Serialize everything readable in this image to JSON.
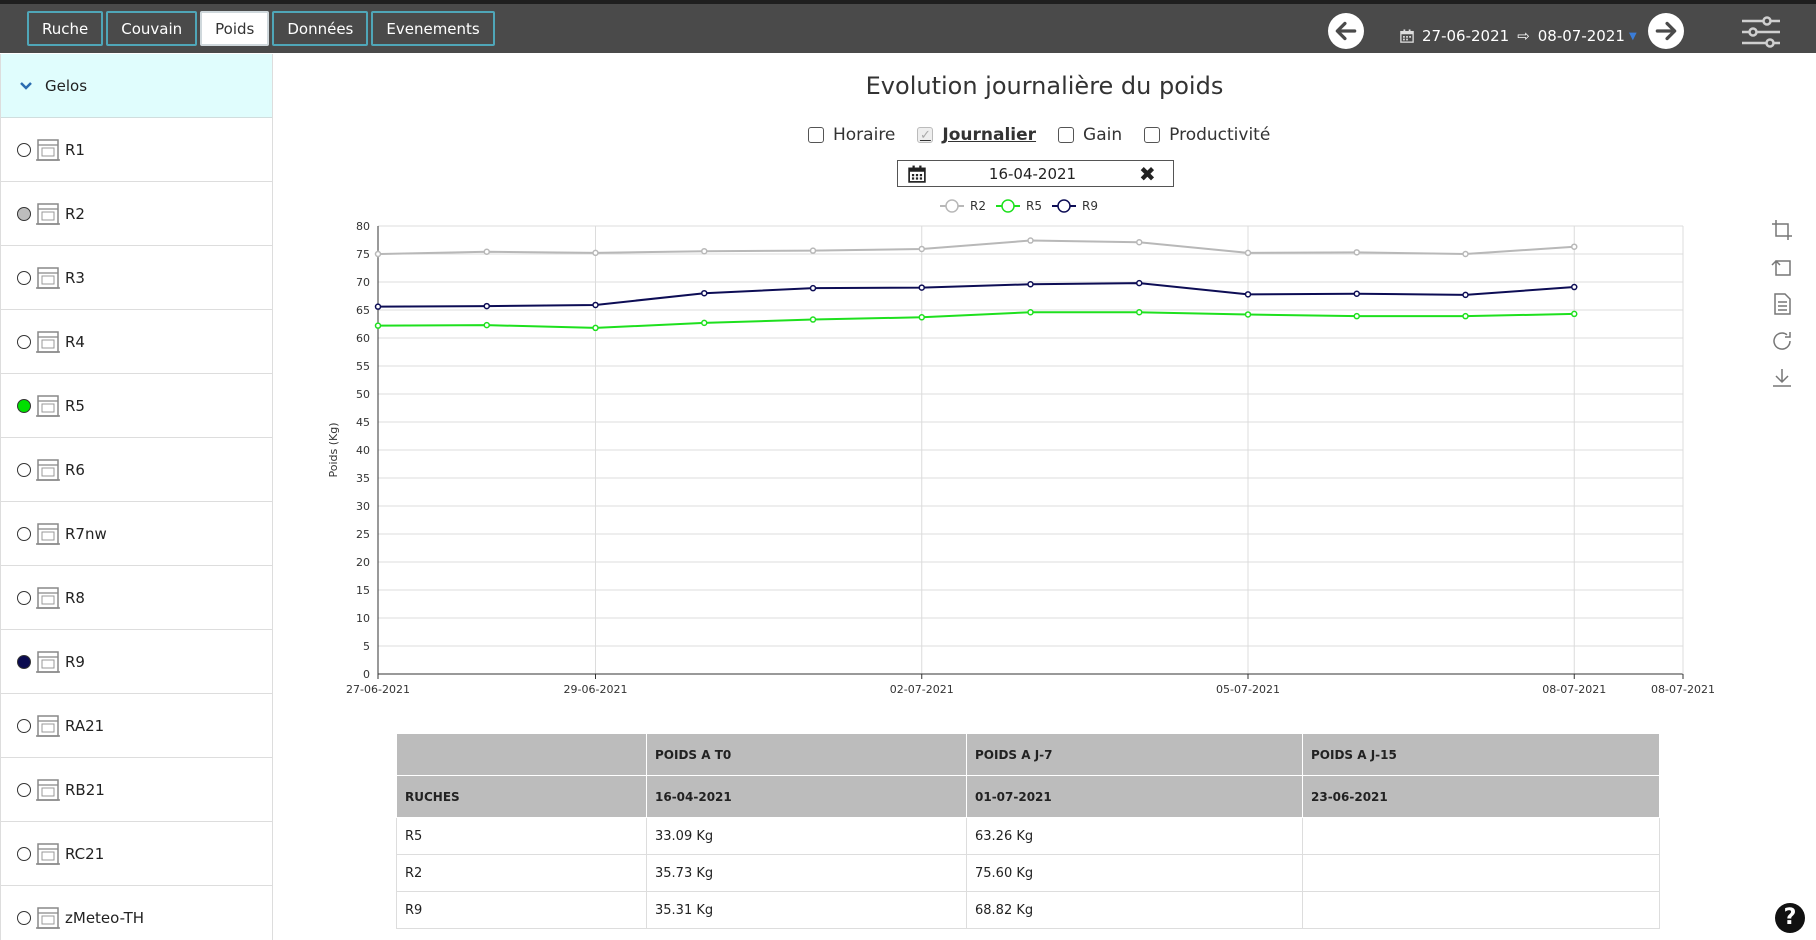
{
  "tabs": [
    "Ruche",
    "Couvain",
    "Poids",
    "Données",
    "Evenements"
  ],
  "active_tab": 2,
  "date_range": {
    "start": "27-06-2021",
    "end": "08-07-2021"
  },
  "sidebar": {
    "group": "Gelos",
    "hives": [
      {
        "name": "R1",
        "color": ""
      },
      {
        "name": "R2",
        "color": "#bdbdbd"
      },
      {
        "name": "R3",
        "color": ""
      },
      {
        "name": "R4",
        "color": ""
      },
      {
        "name": "R5",
        "color": "#00e000"
      },
      {
        "name": "R6",
        "color": ""
      },
      {
        "name": "R7nw",
        "color": ""
      },
      {
        "name": "R8",
        "color": ""
      },
      {
        "name": "R9",
        "color": "#0b0b4f"
      },
      {
        "name": "RA21",
        "color": ""
      },
      {
        "name": "RB21",
        "color": ""
      },
      {
        "name": "RC21",
        "color": ""
      },
      {
        "name": "zMeteo-TH",
        "color": ""
      }
    ]
  },
  "main": {
    "title": "Evolution journalière du poids",
    "options": [
      {
        "label": "Horaire",
        "checked": false
      },
      {
        "label": "Journalier",
        "checked": true
      },
      {
        "label": "Gain",
        "checked": false
      },
      {
        "label": "Productivité",
        "checked": false
      }
    ],
    "ref_date": "16-04-2021"
  },
  "chart_data": {
    "type": "line",
    "ylabel": "Poids (Kg)",
    "ylim": [
      0,
      80
    ],
    "ytick_step": 5,
    "x_dates": [
      "27-06-2021",
      "28-06-2021",
      "29-06-2021",
      "30-06-2021",
      "01-07-2021",
      "02-07-2021",
      "03-07-2021",
      "04-07-2021",
      "05-07-2021",
      "06-07-2021",
      "07-07-2021",
      "08-07-2021"
    ],
    "x_ticks": [
      "27-06-2021",
      "29-06-2021",
      "02-07-2021",
      "05-07-2021",
      "08-07-2021",
      "08-07-2021"
    ],
    "legend_position": "top-center",
    "grid": true,
    "series": [
      {
        "name": "R2",
        "color": "#b8b8b8",
        "values": [
          75.0,
          75.4,
          75.2,
          75.5,
          75.6,
          75.9,
          77.4,
          77.1,
          75.2,
          75.3,
          75.0,
          76.3
        ]
      },
      {
        "name": "R5",
        "color": "#1ee01e",
        "values": [
          62.2,
          62.3,
          61.8,
          62.7,
          63.3,
          63.7,
          64.6,
          64.6,
          64.2,
          63.9,
          63.9,
          64.3
        ]
      },
      {
        "name": "R9",
        "color": "#0d0d55",
        "values": [
          65.6,
          65.7,
          65.9,
          68.0,
          68.9,
          69.0,
          69.6,
          69.8,
          67.8,
          67.9,
          67.7,
          69.1
        ]
      }
    ]
  },
  "table": {
    "header_top": [
      "",
      "POIDS A T0",
      "POIDS A J-7",
      "POIDS A J-15"
    ],
    "header_bottom": [
      "RUCHES",
      "16-04-2021",
      "01-07-2021",
      "23-06-2021"
    ],
    "rows": [
      [
        "R5",
        "33.09 Kg",
        "63.26 Kg",
        ""
      ],
      [
        "R2",
        "35.73 Kg",
        "75.60 Kg",
        ""
      ],
      [
        "R9",
        "35.31 Kg",
        "68.82 Kg",
        ""
      ]
    ]
  },
  "icons": {
    "prev": "arrow-left-icon",
    "next": "arrow-right-icon",
    "settings": "sliders-icon",
    "tools": [
      "zoom-icon",
      "zoom-reset-icon",
      "data-view-icon",
      "restore-icon",
      "download-icon"
    ],
    "help": "help-icon"
  },
  "help_label": "?"
}
